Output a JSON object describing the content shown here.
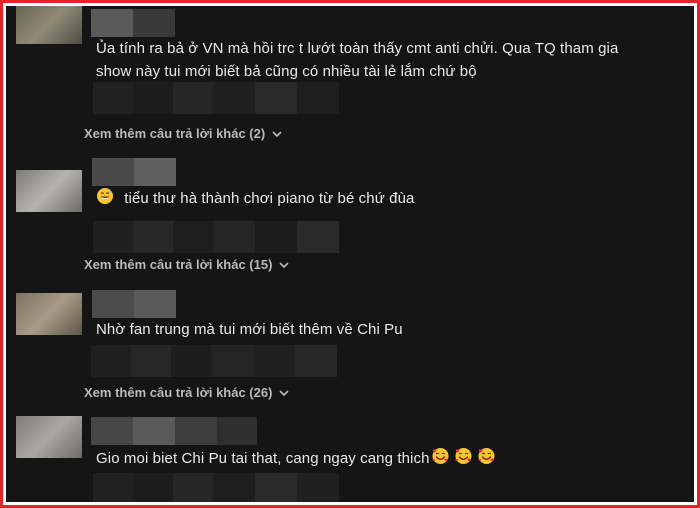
{
  "comments": [
    {
      "text": "Ủa tính ra bả ở VN mà hồi trc t lướt toàn thấy cmt anti chửi. Qua TQ tham gia show này tui mới biết bả cũng có nhiều tài lẻ lắm chứ bộ"
    },
    {
      "emoji_icon": "grinning-sweat-emoji",
      "text": "tiểu thư hà thành chơi piano từ bé chứ đùa"
    },
    {
      "text": "Nhờ fan trung mà tui mới biết thêm về Chi Pu"
    },
    {
      "text": "Gio moi biet Chi Pu tai that, cang ngay cang thich",
      "trailing_icons": [
        "smiling-face-with-hearts-emoji",
        "smiling-face-with-hearts-emoji",
        "smiling-face-with-hearts-emoji"
      ]
    }
  ],
  "more_replies": [
    {
      "label": "Xem thêm câu trả lời khác (2)"
    },
    {
      "label": "Xem thêm câu trả lời khác (15)"
    },
    {
      "label": "Xem thêm câu trả lời khác (26)"
    }
  ],
  "colors": {
    "frame": "#e0262b",
    "background": "#151515",
    "text": "#e9e9e9",
    "link": "#b9b9b9"
  }
}
